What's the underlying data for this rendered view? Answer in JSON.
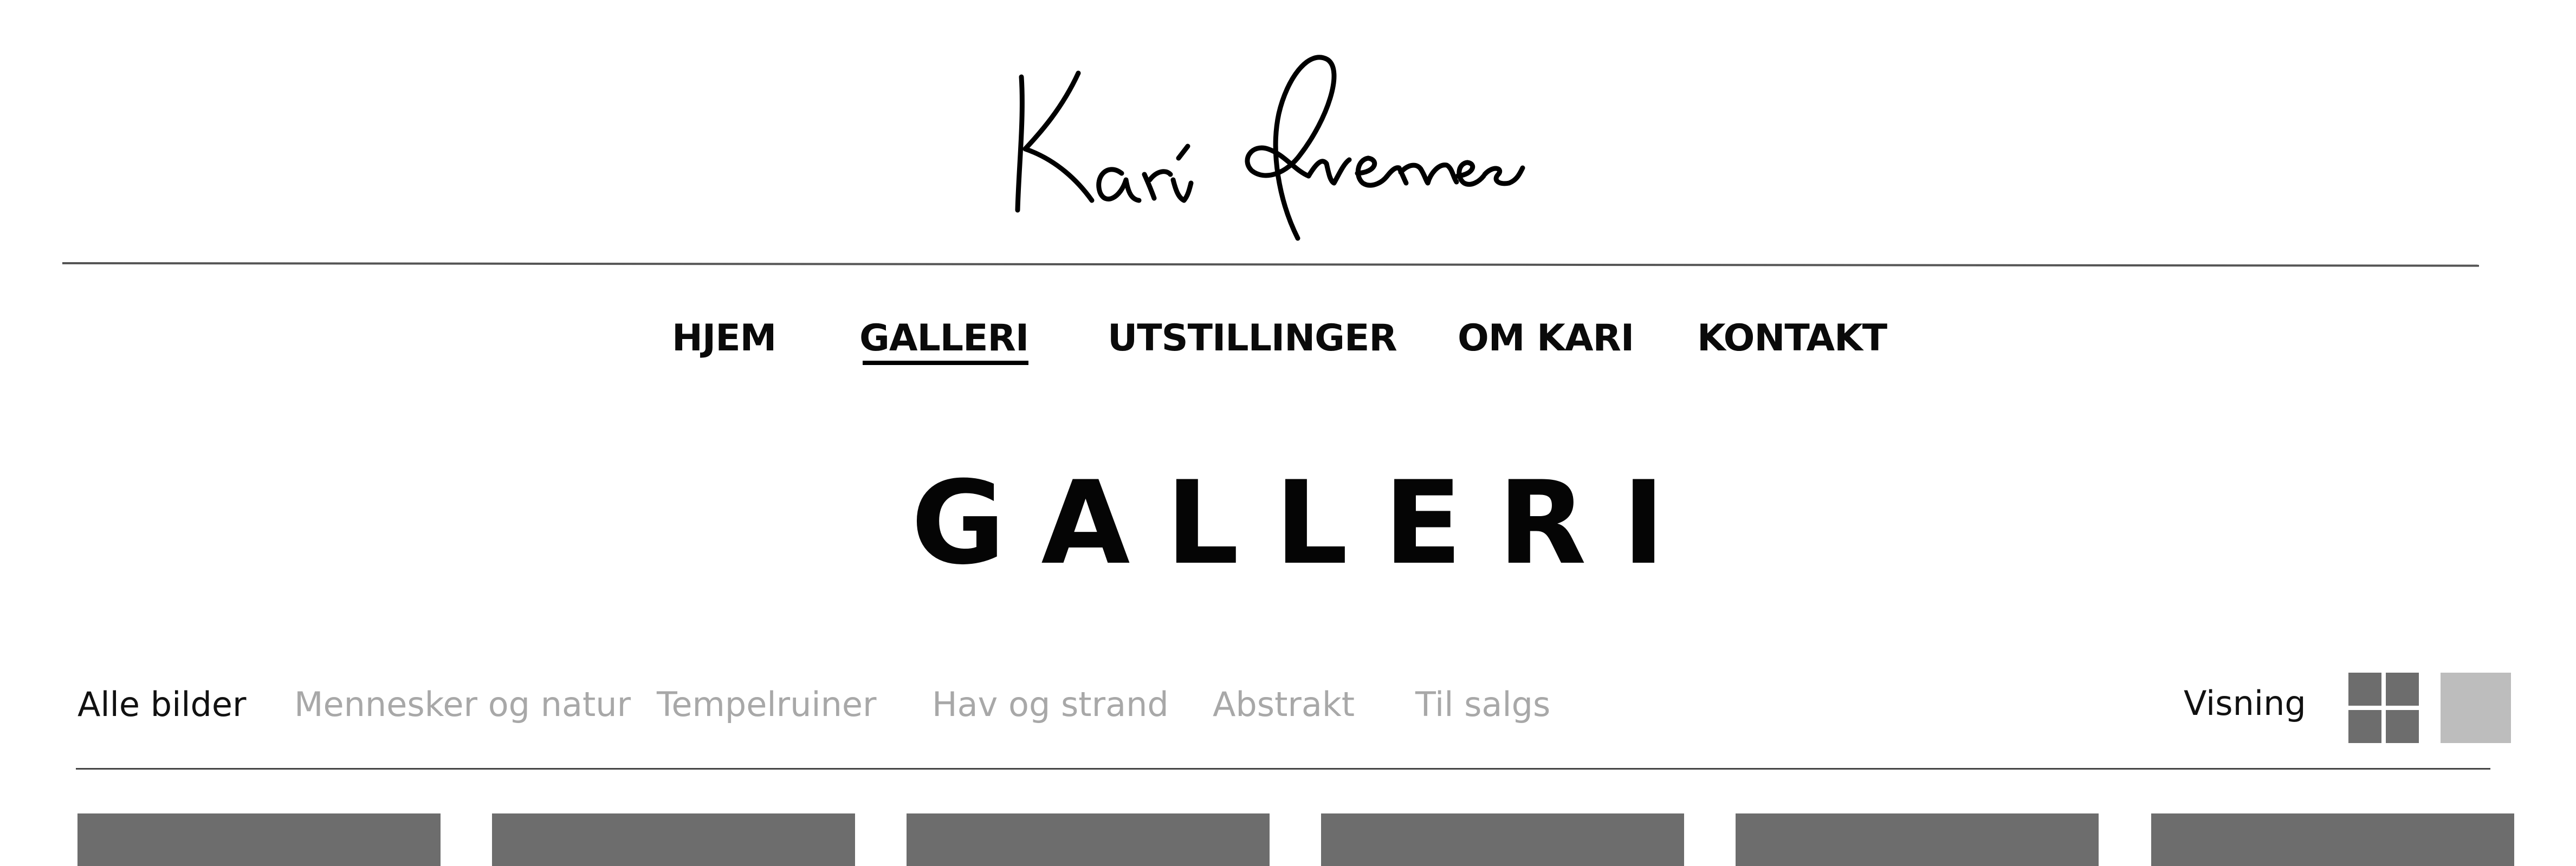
{
  "logo": {
    "text": "Kari Overnes",
    "icon": "signature-logo"
  },
  "nav": {
    "items": [
      {
        "label": "HJEM"
      },
      {
        "label": "GALLERI",
        "active": true
      },
      {
        "label": "UTSTILLINGER"
      },
      {
        "label": "OM KARI"
      },
      {
        "label": "KONTAKT"
      }
    ]
  },
  "page": {
    "title": "GALLERI"
  },
  "filters": {
    "items": [
      {
        "label": "Alle bilder",
        "active": true
      },
      {
        "label": "Mennesker og natur"
      },
      {
        "label": "Tempelruiner"
      },
      {
        "label": "Hav og strand"
      },
      {
        "label": "Abstrakt"
      },
      {
        "label": "Til salgs"
      }
    ],
    "view_label": "Visning",
    "view_options": [
      "grid-view-icon",
      "single-view-icon"
    ],
    "selected_view": "grid-view-icon"
  },
  "gallery": {
    "thumbnail_count": 6
  },
  "colors": {
    "text": "#0a0a0a",
    "inactive_filter": "#a8a8a8",
    "thumbnail_placeholder": "#6d6d6d",
    "view_inactive": "#bdbdbd"
  }
}
